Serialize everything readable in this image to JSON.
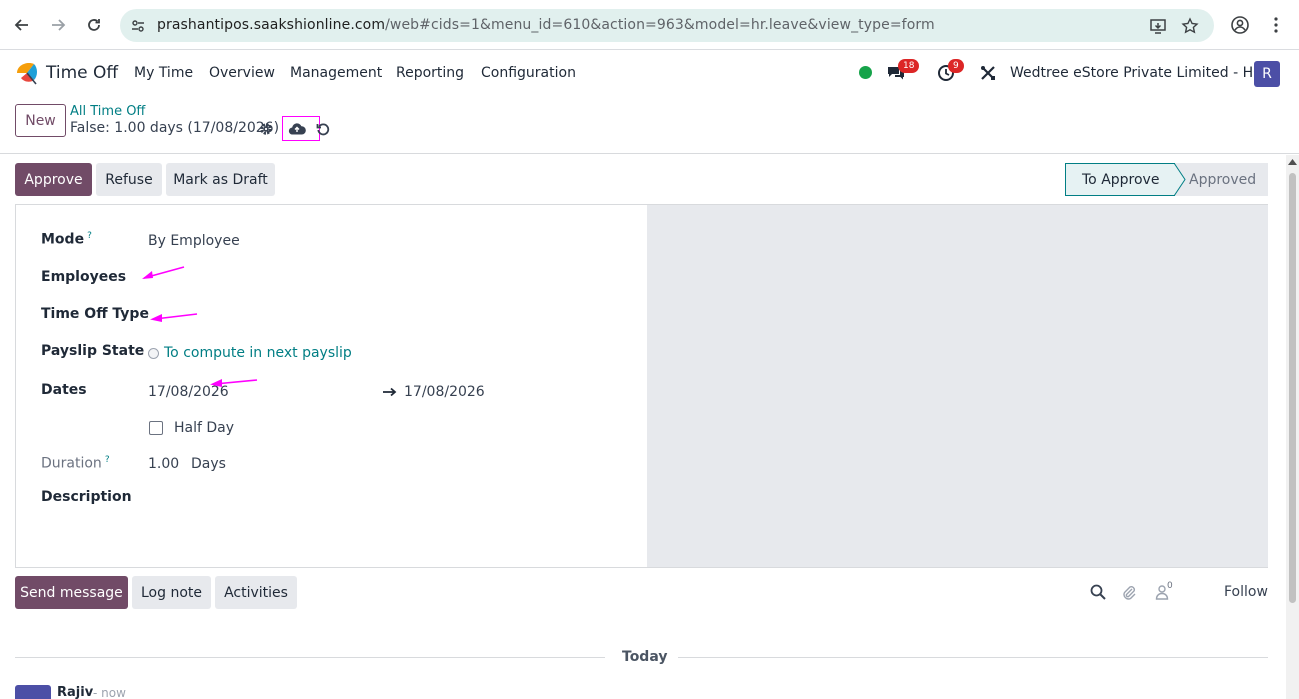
{
  "browser": {
    "url_host": "prashantipos.saakshionline.com",
    "url_path": "/web#cids=1&menu_id=610&action=963&model=hr.leave&view_type=form"
  },
  "navbar": {
    "app_name": "Time Off",
    "menu": [
      "My Time",
      "Overview",
      "Management",
      "Reporting",
      "Configuration"
    ],
    "messages_count": "18",
    "activities_count": "9",
    "company": "Wedtree eStore Private Limited - HO",
    "avatar_letter": "R"
  },
  "control_panel": {
    "new_label": "New",
    "breadcrumb": "All Time Off",
    "record_title": "False: 1.00 days (17/08/2026)"
  },
  "actions": {
    "approve": "Approve",
    "refuse": "Refuse",
    "mark_draft": "Mark as Draft"
  },
  "statusbar": {
    "active": "To Approve",
    "next": "Approved"
  },
  "form": {
    "mode_label": "Mode",
    "mode_help": "?",
    "mode_value": "By Employee",
    "employees_label": "Employees",
    "type_label": "Time Off Type",
    "payslip_label": "Payslip State",
    "payslip_value": "To compute in next payslip",
    "dates_label": "Dates",
    "date_from": "17/08/2026",
    "date_to": "17/08/2026",
    "half_day_label": "Half Day",
    "duration_label": "Duration",
    "duration_help": "?",
    "duration_value": "1.00",
    "duration_unit": "Days",
    "description_label": "Description"
  },
  "chatter": {
    "send_message": "Send message",
    "log_note": "Log note",
    "activities": "Activities",
    "followers_count": "0",
    "follow": "Follow",
    "today": "Today",
    "author": "Rajiv",
    "time": "- now"
  },
  "colors": {
    "primary": "#714b67",
    "link": "#017e84",
    "annotation": "#ff00ff"
  }
}
